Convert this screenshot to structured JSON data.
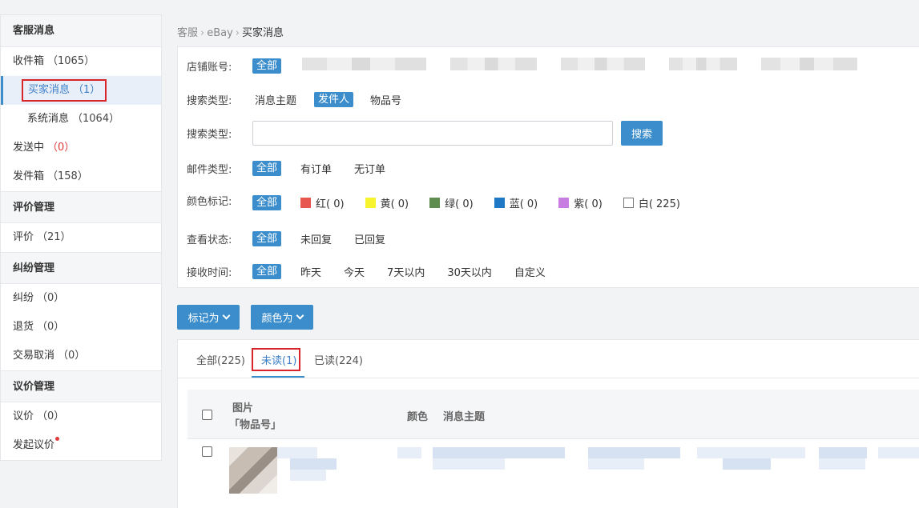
{
  "sidebar": {
    "sections": [
      {
        "title": "客服消息",
        "items": [
          {
            "label": "收件箱",
            "count": "（1065）"
          },
          {
            "label": "买家消息",
            "count": "（1）"
          },
          {
            "label": "系统消息",
            "count": "（1064）"
          },
          {
            "label": "发送中",
            "count": "（0）"
          },
          {
            "label": "发件箱",
            "count": "（158）"
          }
        ]
      },
      {
        "title": "评价管理",
        "items": [
          {
            "label": "评价",
            "count": "（21）"
          }
        ]
      },
      {
        "title": "纠纷管理",
        "items": [
          {
            "label": "纠纷",
            "count": "（0）"
          },
          {
            "label": "退货",
            "count": "（0）"
          },
          {
            "label": "交易取消",
            "count": "（0）"
          }
        ]
      },
      {
        "title": "议价管理",
        "items": [
          {
            "label": "议价",
            "count": "（0）"
          },
          {
            "label": "发起议价",
            "count": ""
          }
        ]
      }
    ]
  },
  "breadcrumb": {
    "items": [
      "客服",
      "eBay",
      "买家消息"
    ]
  },
  "filters": {
    "store": {
      "label": "店铺账号:",
      "all": "全部"
    },
    "search_type": {
      "label": "搜索类型:",
      "options": [
        "消息主题",
        "发件人",
        "物品号"
      ],
      "selected": "发件人"
    },
    "search_box": {
      "label": "搜索类型:",
      "value": "",
      "button": "搜索"
    },
    "mail_type": {
      "label": "邮件类型:",
      "all": "全部",
      "options": [
        "有订单",
        "无订单"
      ]
    },
    "color_tag": {
      "label": "颜色标记:",
      "all": "全部",
      "options": [
        {
          "label": "红( 0)",
          "color": "#e8574f"
        },
        {
          "label": "黄( 0)",
          "color": "#f7f32c"
        },
        {
          "label": "绿( 0)",
          "color": "#5e8d4f"
        },
        {
          "label": "蓝( 0)",
          "color": "#1f78c6"
        },
        {
          "label": "紫( 0)",
          "color": "#c77ee0"
        },
        {
          "label": "白( 225)",
          "color": "#ffffff"
        }
      ]
    },
    "view_status": {
      "label": "查看状态:",
      "all": "全部",
      "options": [
        "未回复",
        "已回复"
      ]
    },
    "receive_time": {
      "label": "接收时间:",
      "all": "全部",
      "options": [
        "昨天",
        "今天",
        "7天以内",
        "30天以内",
        "自定义"
      ]
    }
  },
  "actions": {
    "mark_as": "标记为",
    "color_as": "颜色为"
  },
  "tabs": [
    {
      "label": "全部(225)"
    },
    {
      "label": "未读(1)",
      "active": true
    },
    {
      "label": "已读(224)"
    }
  ],
  "table": {
    "headers": {
      "image": "图片",
      "item_no": "「物品号」",
      "color": "颜色",
      "subject": "消息主题"
    }
  },
  "colors": {
    "accent": "#3c8dcb",
    "highlight_box": "#d9242b"
  }
}
